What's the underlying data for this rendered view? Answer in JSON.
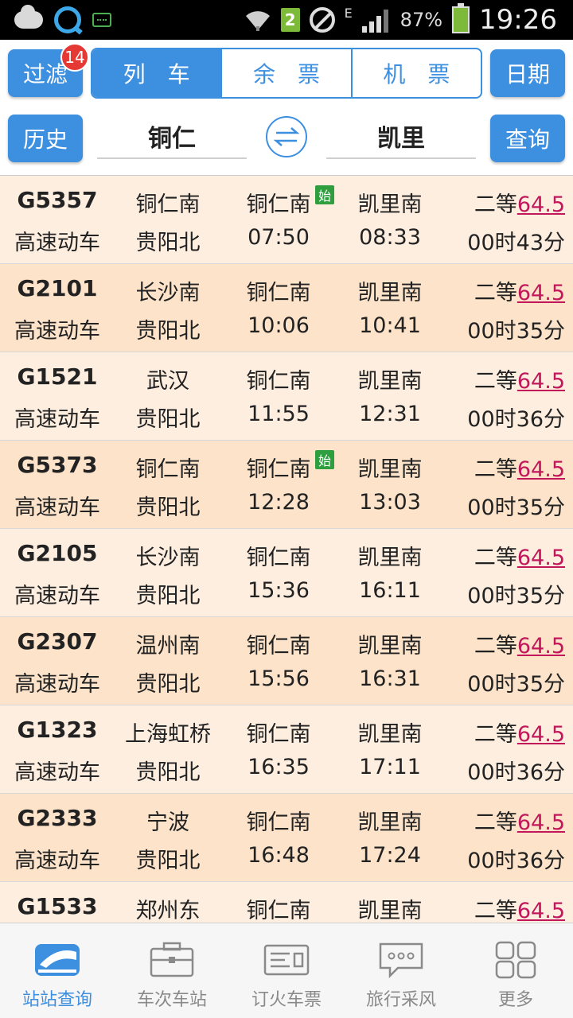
{
  "status_bar": {
    "sim_slot": "2",
    "network": "E",
    "battery": "87%",
    "time": "19:26"
  },
  "toolbar": {
    "filter_label": "过滤",
    "filter_badge": "14",
    "tabs": [
      "列车",
      "余票",
      "机票"
    ],
    "active_tab": 0,
    "date_label": "日期",
    "history_label": "历史",
    "from_station": "铜仁",
    "to_station": "凯里",
    "query_label": "查询"
  },
  "columns": [
    "train",
    "origin_type",
    "dep_station_time",
    "arr_station_time",
    "seat_price_duration"
  ],
  "trains": [
    {
      "no": "G5357",
      "type": "高速动车",
      "origin": "铜仁南",
      "terminus": "贵阳北",
      "dep_station": "铜仁南",
      "dep_time": "07:50",
      "arr_station": "凯里南",
      "arr_time": "08:33",
      "seat": "二等",
      "price": "64.5",
      "duration": "00时43分",
      "start": true
    },
    {
      "no": "G2101",
      "type": "高速动车",
      "origin": "长沙南",
      "terminus": "贵阳北",
      "dep_station": "铜仁南",
      "dep_time": "10:06",
      "arr_station": "凯里南",
      "arr_time": "10:41",
      "seat": "二等",
      "price": "64.5",
      "duration": "00时35分",
      "start": false
    },
    {
      "no": "G1521",
      "type": "高速动车",
      "origin": "武汉",
      "terminus": "贵阳北",
      "dep_station": "铜仁南",
      "dep_time": "11:55",
      "arr_station": "凯里南",
      "arr_time": "12:31",
      "seat": "二等",
      "price": "64.5",
      "duration": "00时36分",
      "start": false
    },
    {
      "no": "G5373",
      "type": "高速动车",
      "origin": "铜仁南",
      "terminus": "贵阳北",
      "dep_station": "铜仁南",
      "dep_time": "12:28",
      "arr_station": "凯里南",
      "arr_time": "13:03",
      "seat": "二等",
      "price": "64.5",
      "duration": "00时35分",
      "start": true
    },
    {
      "no": "G2105",
      "type": "高速动车",
      "origin": "长沙南",
      "terminus": "贵阳北",
      "dep_station": "铜仁南",
      "dep_time": "15:36",
      "arr_station": "凯里南",
      "arr_time": "16:11",
      "seat": "二等",
      "price": "64.5",
      "duration": "00时35分",
      "start": false
    },
    {
      "no": "G2307",
      "type": "高速动车",
      "origin": "温州南",
      "terminus": "贵阳北",
      "dep_station": "铜仁南",
      "dep_time": "15:56",
      "arr_station": "凯里南",
      "arr_time": "16:31",
      "seat": "二等",
      "price": "64.5",
      "duration": "00时35分",
      "start": false
    },
    {
      "no": "G1323",
      "type": "高速动车",
      "origin": "上海虹桥",
      "terminus": "贵阳北",
      "dep_station": "铜仁南",
      "dep_time": "16:35",
      "arr_station": "凯里南",
      "arr_time": "17:11",
      "seat": "二等",
      "price": "64.5",
      "duration": "00时36分",
      "start": false
    },
    {
      "no": "G2333",
      "type": "高速动车",
      "origin": "宁波",
      "terminus": "贵阳北",
      "dep_station": "铜仁南",
      "dep_time": "16:48",
      "arr_station": "凯里南",
      "arr_time": "17:24",
      "seat": "二等",
      "price": "64.5",
      "duration": "00时36分",
      "start": false
    },
    {
      "no": "G1533",
      "type": "",
      "origin": "郑州东",
      "terminus": "",
      "dep_station": "铜仁南",
      "dep_time": "",
      "arr_station": "凯里南",
      "arr_time": "",
      "seat": "二等",
      "price": "64.5",
      "duration": "",
      "start": false
    }
  ],
  "start_badge_text": "始",
  "bottom_nav": [
    {
      "label": "站站查询",
      "icon": "train-icon",
      "active": true
    },
    {
      "label": "车次车站",
      "icon": "briefcase-icon",
      "active": false
    },
    {
      "label": "订火车票",
      "icon": "ticket-icon",
      "active": false
    },
    {
      "label": "旅行采风",
      "icon": "chat-bubble-icon",
      "active": false
    },
    {
      "label": "更多",
      "icon": "grid-icon",
      "active": false
    }
  ],
  "colors": {
    "accent": "#3d8fe0",
    "row_light": "#fdeee0",
    "row_dark": "#fce3c9",
    "price": "#c2185b",
    "badge": "#e53935",
    "start_badge": "#2e9e3e"
  }
}
